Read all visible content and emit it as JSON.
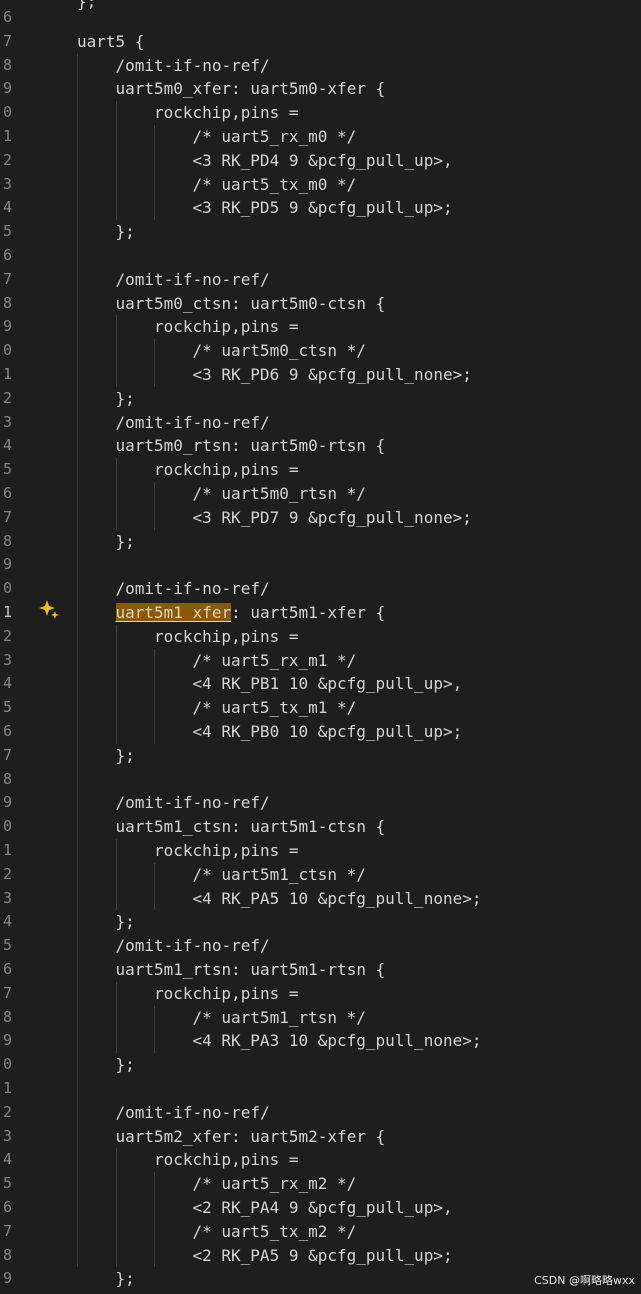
{
  "editor": {
    "top_fragment": "};",
    "active_line_index": 25,
    "lines": [
      {
        "gutter": "6",
        "text": ""
      },
      {
        "gutter": "7",
        "text": "uart5 {"
      },
      {
        "gutter": "8",
        "text": "/omit-if-no-ref/"
      },
      {
        "gutter": "9",
        "text": "uart5m0_xfer: uart5m0-xfer {"
      },
      {
        "gutter": "0",
        "text": "rockchip,pins ="
      },
      {
        "gutter": "1",
        "text": "/* uart5_rx_m0 */"
      },
      {
        "gutter": "2",
        "text": "<3 RK_PD4 9 &pcfg_pull_up>,"
      },
      {
        "gutter": "3",
        "text": "/* uart5_tx_m0 */"
      },
      {
        "gutter": "4",
        "text": "<3 RK_PD5 9 &pcfg_pull_up>;"
      },
      {
        "gutter": "5",
        "text": "};"
      },
      {
        "gutter": "6",
        "text": ""
      },
      {
        "gutter": "7",
        "text": "/omit-if-no-ref/"
      },
      {
        "gutter": "8",
        "text": "uart5m0_ctsn: uart5m0-ctsn {"
      },
      {
        "gutter": "9",
        "text": "rockchip,pins ="
      },
      {
        "gutter": "0",
        "text": "/* uart5m0_ctsn */"
      },
      {
        "gutter": "1",
        "text": "<3 RK_PD6 9 &pcfg_pull_none>;"
      },
      {
        "gutter": "2",
        "text": "};"
      },
      {
        "gutter": "3",
        "text": "/omit-if-no-ref/"
      },
      {
        "gutter": "4",
        "text": "uart5m0_rtsn: uart5m0-rtsn {"
      },
      {
        "gutter": "5",
        "text": "rockchip,pins ="
      },
      {
        "gutter": "6",
        "text": "/* uart5m0_rtsn */"
      },
      {
        "gutter": "7",
        "text": "<3 RK_PD7 9 &pcfg_pull_none>;"
      },
      {
        "gutter": "8",
        "text": "};"
      },
      {
        "gutter": "9",
        "text": ""
      },
      {
        "gutter": "0",
        "text": "/omit-if-no-ref/"
      },
      {
        "gutter": "1",
        "text": "uart5m1_xfer: uart5m1-xfer {",
        "highlight": "uart5m1_xfer"
      },
      {
        "gutter": "2",
        "text": "rockchip,pins ="
      },
      {
        "gutter": "3",
        "text": "/* uart5_rx_m1 */"
      },
      {
        "gutter": "4",
        "text": "<4 RK_PB1 10 &pcfg_pull_up>,"
      },
      {
        "gutter": "5",
        "text": "/* uart5_tx_m1 */"
      },
      {
        "gutter": "6",
        "text": "<4 RK_PB0 10 &pcfg_pull_up>;"
      },
      {
        "gutter": "7",
        "text": "};"
      },
      {
        "gutter": "8",
        "text": ""
      },
      {
        "gutter": "9",
        "text": "/omit-if-no-ref/"
      },
      {
        "gutter": "0",
        "text": "uart5m1_ctsn: uart5m1-ctsn {"
      },
      {
        "gutter": "1",
        "text": "rockchip,pins ="
      },
      {
        "gutter": "2",
        "text": "/* uart5m1_ctsn */"
      },
      {
        "gutter": "3",
        "text": "<4 RK_PA5 10 &pcfg_pull_none>;"
      },
      {
        "gutter": "4",
        "text": "};"
      },
      {
        "gutter": "5",
        "text": "/omit-if-no-ref/"
      },
      {
        "gutter": "6",
        "text": "uart5m1_rtsn: uart5m1-rtsn {"
      },
      {
        "gutter": "7",
        "text": "rockchip,pins ="
      },
      {
        "gutter": "8",
        "text": "/* uart5m1_rtsn */"
      },
      {
        "gutter": "9",
        "text": "<4 RK_PA3 10 &pcfg_pull_none>;"
      },
      {
        "gutter": "0",
        "text": "};"
      },
      {
        "gutter": "1",
        "text": ""
      },
      {
        "gutter": "2",
        "text": "/omit-if-no-ref/"
      },
      {
        "gutter": "3",
        "text": "uart5m2_xfer: uart5m2-xfer {"
      },
      {
        "gutter": "4",
        "text": "rockchip,pins ="
      },
      {
        "gutter": "5",
        "text": "/* uart5_rx_m2 */"
      },
      {
        "gutter": "6",
        "text": "<2 RK_PA4 9 &pcfg_pull_up>,"
      },
      {
        "gutter": "7",
        "text": "/* uart5_tx_m2 */"
      },
      {
        "gutter": "8",
        "text": "<2 RK_PA5 9 &pcfg_pull_up>;"
      },
      {
        "gutter": "9",
        "text": "};"
      }
    ]
  },
  "colors": {
    "background": "#1e1e1e",
    "text": "#d4d4d4",
    "line_number": "#858585",
    "highlight": "#8a5a00",
    "sparkle_icon": "#f0c000"
  },
  "icons": {
    "lightbulb": "sparkle-icon"
  },
  "watermark": "CSDN @啊略略wxx"
}
